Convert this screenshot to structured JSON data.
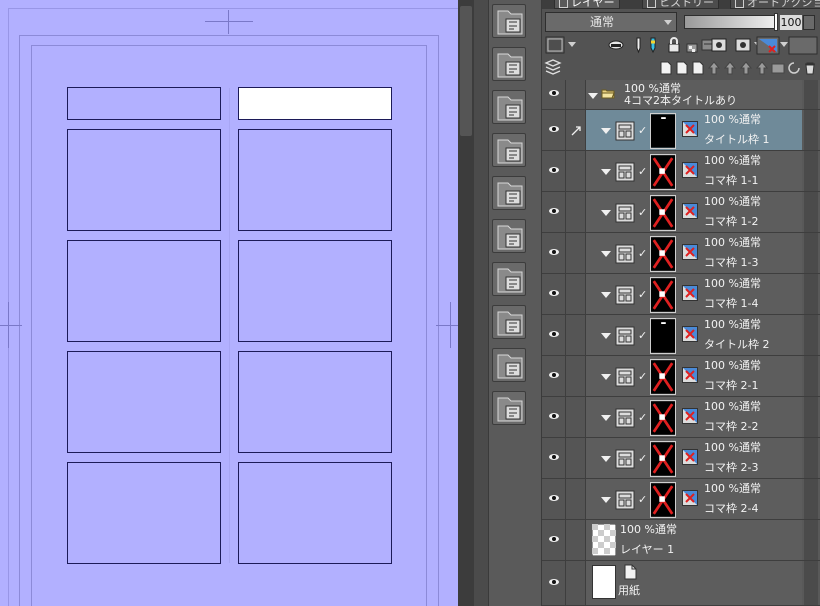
{
  "layer_panel": {
    "tabs": [
      {
        "label": "レイヤー",
        "icon": "layers-icon"
      },
      {
        "label": "ヒストリー",
        "icon": "history-icon"
      },
      {
        "label": "オートアクション",
        "icon": "auto-action-icon"
      }
    ],
    "blend_mode": "通常",
    "opacity": "100",
    "opacity_fraction": 1.0
  },
  "layers": [
    {
      "id": "folder",
      "line1": "100 %通常",
      "line2": "4コマ2本タイトルあり",
      "kind": "folder",
      "icon": "folder-open-icon"
    },
    {
      "id": "title1",
      "line1": "100 %通常",
      "line2": "タイトル枠 1",
      "kind": "frame",
      "selected": true,
      "thumb": "title"
    },
    {
      "id": "k11",
      "line1": "100 %通常",
      "line2": "コマ枠 1-1",
      "kind": "frame",
      "thumb": "x"
    },
    {
      "id": "k12",
      "line1": "100 %通常",
      "line2": "コマ枠 1-2",
      "kind": "frame",
      "thumb": "x"
    },
    {
      "id": "k13",
      "line1": "100 %通常",
      "line2": "コマ枠 1-3",
      "kind": "frame",
      "thumb": "x"
    },
    {
      "id": "k14",
      "line1": "100 %通常",
      "line2": "コマ枠 1-4",
      "kind": "frame",
      "thumb": "x"
    },
    {
      "id": "title2",
      "line1": "100 %通常",
      "line2": "タイトル枠 2",
      "kind": "frame",
      "thumb": "title"
    },
    {
      "id": "k21",
      "line1": "100 %通常",
      "line2": "コマ枠 2-1",
      "kind": "frame",
      "thumb": "x"
    },
    {
      "id": "k22",
      "line1": "100 %通常",
      "line2": "コマ枠 2-2",
      "kind": "frame",
      "thumb": "x"
    },
    {
      "id": "k23",
      "line1": "100 %通常",
      "line2": "コマ枠 2-3",
      "kind": "frame",
      "thumb": "x"
    },
    {
      "id": "k24",
      "line1": "100 %通常",
      "line2": "コマ枠 2-4",
      "kind": "frame",
      "thumb": "x"
    },
    {
      "id": "raster",
      "line1": "100 %通常",
      "line2": "レイヤー 1",
      "kind": "raster"
    },
    {
      "id": "paper",
      "line1": "",
      "line2": "用紙",
      "kind": "paper"
    }
  ],
  "tools": [
    "frame-border-icon",
    "cut-frame-icon",
    "divide-frame-icon",
    "tone-frame-icon",
    "frame-layout-icon",
    "focus-lines-icon",
    "image-layer-icon",
    "edit-layer-icon",
    "3d-object-icon",
    "figure-icon"
  ],
  "colors": {
    "canvas": "#b2b0ff",
    "frame_border": "#1c1a58",
    "selected_panel": "#ffffff",
    "selected_layer": "#6f8a99",
    "mask_red": "#e02020"
  }
}
